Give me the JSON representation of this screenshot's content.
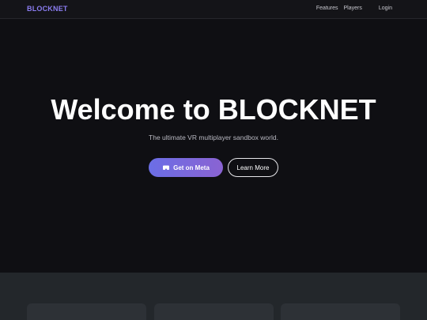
{
  "nav": {
    "brand": "BLOCKNET",
    "links": [
      "Features",
      "Players"
    ],
    "login": "Login"
  },
  "hero": {
    "title": "Welcome to BLOCKNET",
    "subtitle": "The ultimate VR multiplayer sandbox world.",
    "primary_button": "Get on Meta",
    "primary_button_icon": "vr-headset-icon",
    "secondary_button": "Learn More"
  },
  "colors": {
    "background": "#0f0f13",
    "brand": "#8b7df0",
    "primary_gradient_start": "#6b6ee6",
    "primary_gradient_end": "#8a63d2",
    "section_background": "#23272b",
    "card_background": "#2d3136"
  }
}
